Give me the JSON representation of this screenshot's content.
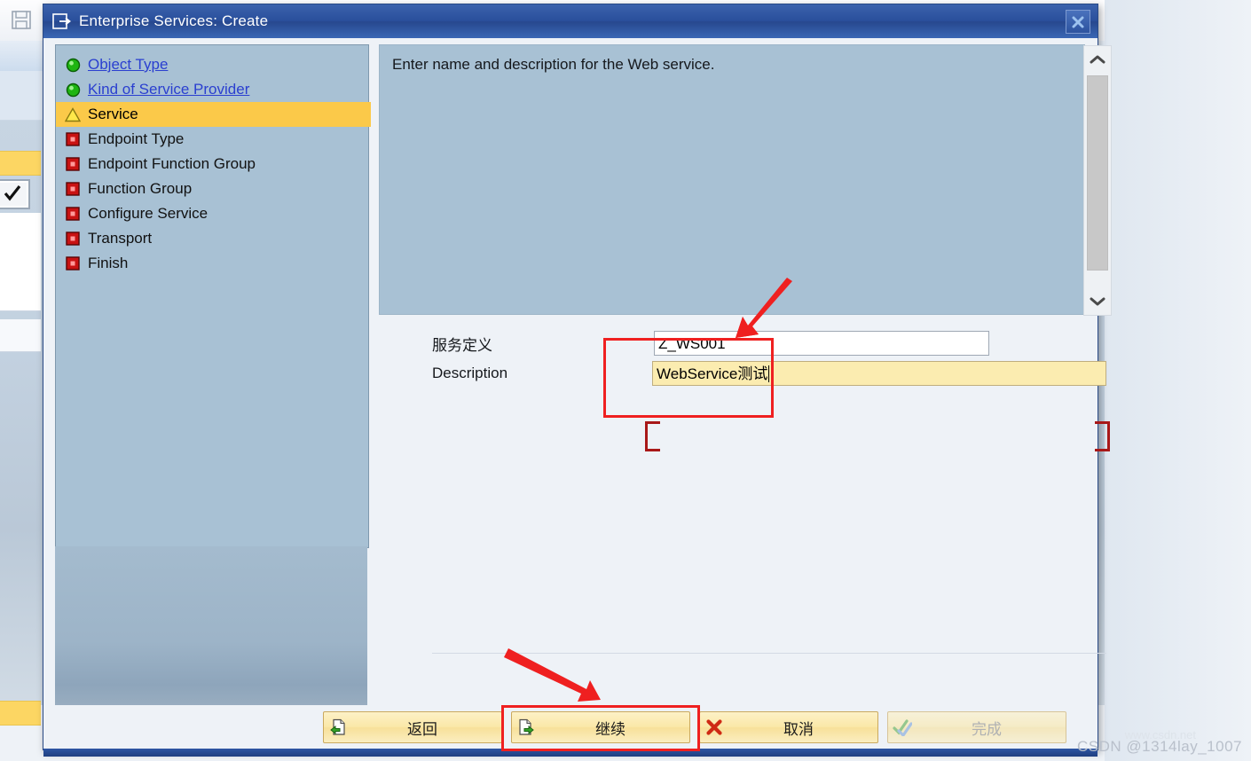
{
  "window": {
    "title": "Enterprise Services: Create",
    "title_icon": "create-object-icon",
    "close_label": "×"
  },
  "roadmap": {
    "items": [
      {
        "label": "Object Type",
        "state": "done",
        "icon": "green-circle-icon"
      },
      {
        "label": "Kind of Service Provider",
        "state": "done",
        "icon": "green-circle-icon"
      },
      {
        "label": "Service",
        "state": "current",
        "icon": "yellow-triangle-icon"
      },
      {
        "label": "Endpoint Type",
        "state": "pending",
        "icon": "red-square-icon"
      },
      {
        "label": "Endpoint Function Group",
        "state": "pending",
        "icon": "red-square-icon"
      },
      {
        "label": "Function Group",
        "state": "pending",
        "icon": "red-square-icon"
      },
      {
        "label": "Configure Service",
        "state": "pending",
        "icon": "red-square-icon"
      },
      {
        "label": "Transport",
        "state": "pending",
        "icon": "red-square-icon"
      },
      {
        "label": "Finish",
        "state": "pending",
        "icon": "red-square-icon"
      }
    ]
  },
  "instructions": {
    "text": "Enter name and description for the Web service."
  },
  "scrollbar": {
    "up_icon": "chevron-up-icon",
    "down_icon": "chevron-down-icon"
  },
  "form": {
    "fields": [
      {
        "label": "服务定义",
        "value": "Z_WS001",
        "state": "normal"
      },
      {
        "label": "Description",
        "value": "WebService测试",
        "state": "focused"
      }
    ]
  },
  "buttons": [
    {
      "label": "返回",
      "icon": "page-back-icon",
      "enabled": true
    },
    {
      "label": "继续",
      "icon": "page-forward-icon",
      "enabled": true
    },
    {
      "label": "取消",
      "icon": "red-x-icon",
      "enabled": true
    },
    {
      "label": "完成",
      "icon": "double-check-icon",
      "enabled": false
    }
  ],
  "annotations": {
    "arrow_to_field": "red-arrow-icon",
    "arrow_to_continue": "red-arrow-icon",
    "highlight_fields": "red-rectangle",
    "highlight_continue": "red-rectangle"
  },
  "watermark": {
    "text": "CSDN @1314lay_1007",
    "site": "www.csdn.net"
  }
}
